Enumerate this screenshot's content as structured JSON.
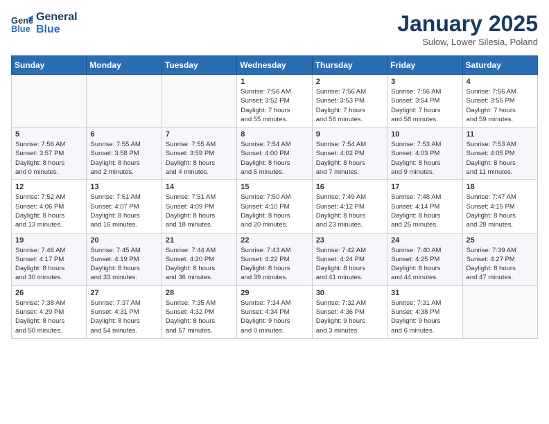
{
  "logo": {
    "line1": "General",
    "line2": "Blue"
  },
  "title": "January 2025",
  "subtitle": "Sulow, Lower Silesia, Poland",
  "days_header": [
    "Sunday",
    "Monday",
    "Tuesday",
    "Wednesday",
    "Thursday",
    "Friday",
    "Saturday"
  ],
  "weeks": [
    [
      {
        "day": "",
        "info": ""
      },
      {
        "day": "",
        "info": ""
      },
      {
        "day": "",
        "info": ""
      },
      {
        "day": "1",
        "info": "Sunrise: 7:56 AM\nSunset: 3:52 PM\nDaylight: 7 hours\nand 55 minutes."
      },
      {
        "day": "2",
        "info": "Sunrise: 7:56 AM\nSunset: 3:53 PM\nDaylight: 7 hours\nand 56 minutes."
      },
      {
        "day": "3",
        "info": "Sunrise: 7:56 AM\nSunset: 3:54 PM\nDaylight: 7 hours\nand 58 minutes."
      },
      {
        "day": "4",
        "info": "Sunrise: 7:56 AM\nSunset: 3:55 PM\nDaylight: 7 hours\nand 59 minutes."
      }
    ],
    [
      {
        "day": "5",
        "info": "Sunrise: 7:56 AM\nSunset: 3:57 PM\nDaylight: 8 hours\nand 0 minutes."
      },
      {
        "day": "6",
        "info": "Sunrise: 7:55 AM\nSunset: 3:58 PM\nDaylight: 8 hours\nand 2 minutes."
      },
      {
        "day": "7",
        "info": "Sunrise: 7:55 AM\nSunset: 3:59 PM\nDaylight: 8 hours\nand 4 minutes."
      },
      {
        "day": "8",
        "info": "Sunrise: 7:54 AM\nSunset: 4:00 PM\nDaylight: 8 hours\nand 5 minutes."
      },
      {
        "day": "9",
        "info": "Sunrise: 7:54 AM\nSunset: 4:02 PM\nDaylight: 8 hours\nand 7 minutes."
      },
      {
        "day": "10",
        "info": "Sunrise: 7:53 AM\nSunset: 4:03 PM\nDaylight: 8 hours\nand 9 minutes."
      },
      {
        "day": "11",
        "info": "Sunrise: 7:53 AM\nSunset: 4:05 PM\nDaylight: 8 hours\nand 11 minutes."
      }
    ],
    [
      {
        "day": "12",
        "info": "Sunrise: 7:52 AM\nSunset: 4:06 PM\nDaylight: 8 hours\nand 13 minutes."
      },
      {
        "day": "13",
        "info": "Sunrise: 7:51 AM\nSunset: 4:07 PM\nDaylight: 8 hours\nand 16 minutes."
      },
      {
        "day": "14",
        "info": "Sunrise: 7:51 AM\nSunset: 4:09 PM\nDaylight: 8 hours\nand 18 minutes."
      },
      {
        "day": "15",
        "info": "Sunrise: 7:50 AM\nSunset: 4:10 PM\nDaylight: 8 hours\nand 20 minutes."
      },
      {
        "day": "16",
        "info": "Sunrise: 7:49 AM\nSunset: 4:12 PM\nDaylight: 8 hours\nand 23 minutes."
      },
      {
        "day": "17",
        "info": "Sunrise: 7:48 AM\nSunset: 4:14 PM\nDaylight: 8 hours\nand 25 minutes."
      },
      {
        "day": "18",
        "info": "Sunrise: 7:47 AM\nSunset: 4:15 PM\nDaylight: 8 hours\nand 28 minutes."
      }
    ],
    [
      {
        "day": "19",
        "info": "Sunrise: 7:46 AM\nSunset: 4:17 PM\nDaylight: 8 hours\nand 30 minutes."
      },
      {
        "day": "20",
        "info": "Sunrise: 7:45 AM\nSunset: 4:19 PM\nDaylight: 8 hours\nand 33 minutes."
      },
      {
        "day": "21",
        "info": "Sunrise: 7:44 AM\nSunset: 4:20 PM\nDaylight: 8 hours\nand 36 minutes."
      },
      {
        "day": "22",
        "info": "Sunrise: 7:43 AM\nSunset: 4:22 PM\nDaylight: 8 hours\nand 39 minutes."
      },
      {
        "day": "23",
        "info": "Sunrise: 7:42 AM\nSunset: 4:24 PM\nDaylight: 8 hours\nand 41 minutes."
      },
      {
        "day": "24",
        "info": "Sunrise: 7:40 AM\nSunset: 4:25 PM\nDaylight: 8 hours\nand 44 minutes."
      },
      {
        "day": "25",
        "info": "Sunrise: 7:39 AM\nSunset: 4:27 PM\nDaylight: 8 hours\nand 47 minutes."
      }
    ],
    [
      {
        "day": "26",
        "info": "Sunrise: 7:38 AM\nSunset: 4:29 PM\nDaylight: 8 hours\nand 50 minutes."
      },
      {
        "day": "27",
        "info": "Sunrise: 7:37 AM\nSunset: 4:31 PM\nDaylight: 8 hours\nand 54 minutes."
      },
      {
        "day": "28",
        "info": "Sunrise: 7:35 AM\nSunset: 4:32 PM\nDaylight: 8 hours\nand 57 minutes."
      },
      {
        "day": "29",
        "info": "Sunrise: 7:34 AM\nSunset: 4:34 PM\nDaylight: 9 hours\nand 0 minutes."
      },
      {
        "day": "30",
        "info": "Sunrise: 7:32 AM\nSunset: 4:36 PM\nDaylight: 9 hours\nand 3 minutes."
      },
      {
        "day": "31",
        "info": "Sunrise: 7:31 AM\nSunset: 4:38 PM\nDaylight: 9 hours\nand 6 minutes."
      },
      {
        "day": "",
        "info": ""
      }
    ]
  ]
}
